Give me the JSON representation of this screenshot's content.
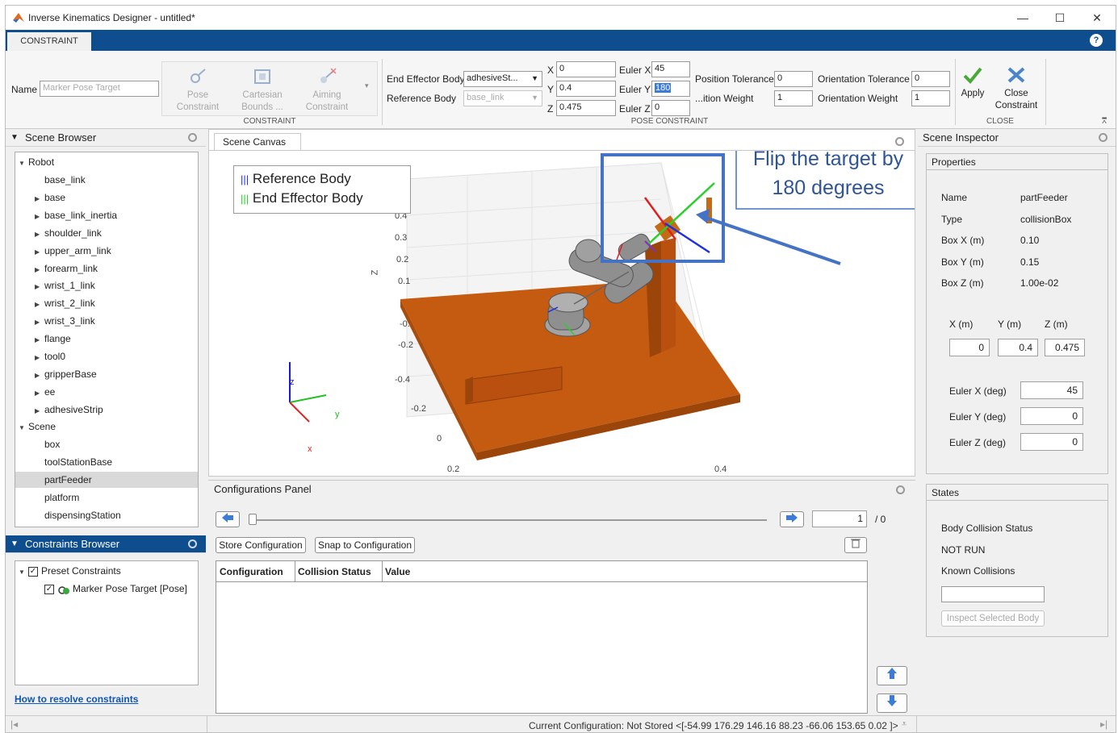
{
  "window": {
    "title": "Inverse Kinematics Designer - untitled*",
    "minimize": "—",
    "maximize": "☐",
    "close": "✕"
  },
  "tab": {
    "label": "CONSTRAINT",
    "help": "?"
  },
  "ribbon": {
    "name_label": "Name",
    "name_placeholder": "Marker Pose Target",
    "constraint_buttons": [
      {
        "label1": "Pose",
        "label2": "Constraint"
      },
      {
        "label1": "Cartesian",
        "label2": "Bounds ..."
      },
      {
        "label1": "Aiming",
        "label2": "Constraint"
      }
    ],
    "section_constraint": "CONSTRAINT",
    "end_effector_label": "End Effector Body",
    "end_effector_value": "adhesiveSt...",
    "reference_label": "Reference Body",
    "reference_value": "base_link",
    "x_label": "X",
    "x_value": "0",
    "y_label": "Y",
    "y_value": "0.4",
    "z_label": "Z",
    "z_value": "0.475",
    "eulerx_label": "Euler X",
    "eulerx_value": "45",
    "eulery_label": "Euler Y",
    "eulery_value": "180",
    "eulerz_label": "Euler Z",
    "eulerz_value": "0",
    "pos_tol_label": "Position Tolerance",
    "pos_tol_value": "0",
    "pos_weight_label": "...ition Weight",
    "pos_weight_value": "1",
    "ori_tol_label": "Orientation Tolerance",
    "ori_tol_value": "0",
    "ori_weight_label": "Orientation Weight",
    "ori_weight_value": "1",
    "section_pose": "POSE CONSTRAINT",
    "apply_label": "Apply",
    "close_label1": "Close",
    "close_label2": "Constraint",
    "section_close": "CLOSE"
  },
  "scene_browser": {
    "title": "Scene Browser",
    "robot_root": "Robot",
    "robot_items": [
      {
        "label": "base_link",
        "expandable": false
      },
      {
        "label": "base",
        "expandable": true
      },
      {
        "label": "base_link_inertia",
        "expandable": true
      },
      {
        "label": "shoulder_link",
        "expandable": true
      },
      {
        "label": "upper_arm_link",
        "expandable": true
      },
      {
        "label": "forearm_link",
        "expandable": true
      },
      {
        "label": "wrist_1_link",
        "expandable": true
      },
      {
        "label": "wrist_2_link",
        "expandable": true
      },
      {
        "label": "wrist_3_link",
        "expandable": true
      },
      {
        "label": "flange",
        "expandable": true
      },
      {
        "label": "tool0",
        "expandable": true
      },
      {
        "label": "gripperBase",
        "expandable": true
      },
      {
        "label": "ee",
        "expandable": true
      },
      {
        "label": "adhesiveStrip",
        "expandable": true
      }
    ],
    "scene_root": "Scene",
    "scene_items": [
      "box",
      "toolStationBase",
      "partFeeder",
      "platform",
      "dispensingStation"
    ],
    "selected": "partFeeder"
  },
  "constraints_browser": {
    "title": "Constraints Browser",
    "preset": "Preset Constraints",
    "item": "Marker Pose Target [Pose]",
    "link": "How to resolve constraints"
  },
  "canvas": {
    "tab": "Scene Canvas",
    "legend": [
      "Reference Body",
      "End Effector Body"
    ],
    "axis_ticks_z": [
      "0.4",
      "0.3",
      "0.2",
      "0.1",
      "-0.",
      "-0.2",
      "-0.4",
      "-0.2",
      "0",
      "0.2"
    ],
    "axis_ticks_x": [
      "0.2",
      "0.4",
      "0.2"
    ],
    "axis_name_z": "Z",
    "triad": {
      "z": "z",
      "y": "y",
      "x": "x"
    },
    "callout": {
      "line1": "Flip the target by",
      "line2": "180 degrees"
    }
  },
  "config_panel": {
    "title": "Configurations Panel",
    "slider_value": "1",
    "slider_total": "/ 0",
    "store_btn": "Store Configuration",
    "snap_btn": "Snap to Configuration",
    "columns": [
      "Configuration",
      "Collision Status",
      "Value"
    ]
  },
  "inspector": {
    "title": "Scene Inspector",
    "properties_title": "Properties",
    "rows": [
      {
        "k": "Name",
        "v": "partFeeder"
      },
      {
        "k": "Type",
        "v": "collisionBox"
      },
      {
        "k": "Box X (m)",
        "v": "0.10"
      },
      {
        "k": "Box Y (m)",
        "v": "0.15"
      },
      {
        "k": "Box Z (m)",
        "v": "1.00e-02"
      }
    ],
    "xyz_labels": [
      "X (m)",
      "Y (m)",
      "Z (m)"
    ],
    "xyz_values": [
      "0",
      "0.4",
      "0.475"
    ],
    "euler": [
      {
        "k": "Euler X (deg)",
        "v": "45"
      },
      {
        "k": "Euler Y (deg)",
        "v": "0"
      },
      {
        "k": "Euler Z (deg)",
        "v": "0"
      }
    ],
    "states_title": "States",
    "body_collision": "Body Collision Status",
    "not_run": "NOT RUN",
    "known": "Known Collisions",
    "inspect_btn": "Inspect Selected Body"
  },
  "status": {
    "text": "Current Configuration: Not Stored <[-54.99 176.29 146.16 88.23 -66.06 153.65 0.02 ]>"
  },
  "colors": {
    "accent": "#0e4d8e",
    "platform": "#c55a11",
    "callout": "#4472c4"
  }
}
